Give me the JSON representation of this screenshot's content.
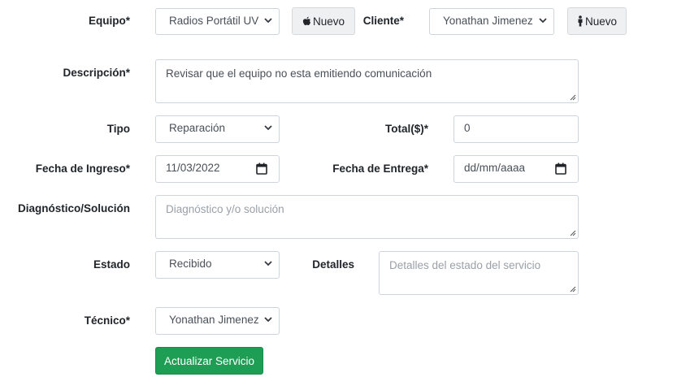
{
  "colors": {
    "primary_button": "#1e9e55",
    "secondary_button": "#eef0f2",
    "border": "#ced4da",
    "placeholder": "#9aa0a6"
  },
  "form": {
    "equipo": {
      "label": "Equipo*",
      "value": "Radios Portátil UV"
    },
    "equipo_nuevo": {
      "label": "Nuevo",
      "icon": "apple-icon"
    },
    "cliente": {
      "label": "Cliente*",
      "value": "Yonathan Jimenez"
    },
    "cliente_nuevo": {
      "label": "Nuevo",
      "icon": "person-icon"
    },
    "descripcion": {
      "label": "Descripción*",
      "value": "Revisar que el equipo no esta emitiendo comunicación"
    },
    "tipo": {
      "label": "Tipo",
      "value": "Reparación"
    },
    "total": {
      "label": "Total($)*",
      "value": "0"
    },
    "fecha_ingreso": {
      "label": "Fecha de Ingreso*",
      "value": "11/03/2022"
    },
    "fecha_entrega": {
      "label": "Fecha de Entrega*",
      "placeholder": "dd/mm/aaaa"
    },
    "diagnostico": {
      "label": "Diagnóstico/Solución",
      "placeholder": "Diagnóstico y/o solución"
    },
    "estado": {
      "label": "Estado",
      "value": "Recibido"
    },
    "detalles": {
      "label": "Detalles",
      "placeholder": "Detalles del estado del servicio"
    },
    "tecnico": {
      "label": "Técnico*",
      "value": "Yonathan Jimenez"
    },
    "submit": {
      "label": "Actualizar Servicio"
    }
  }
}
